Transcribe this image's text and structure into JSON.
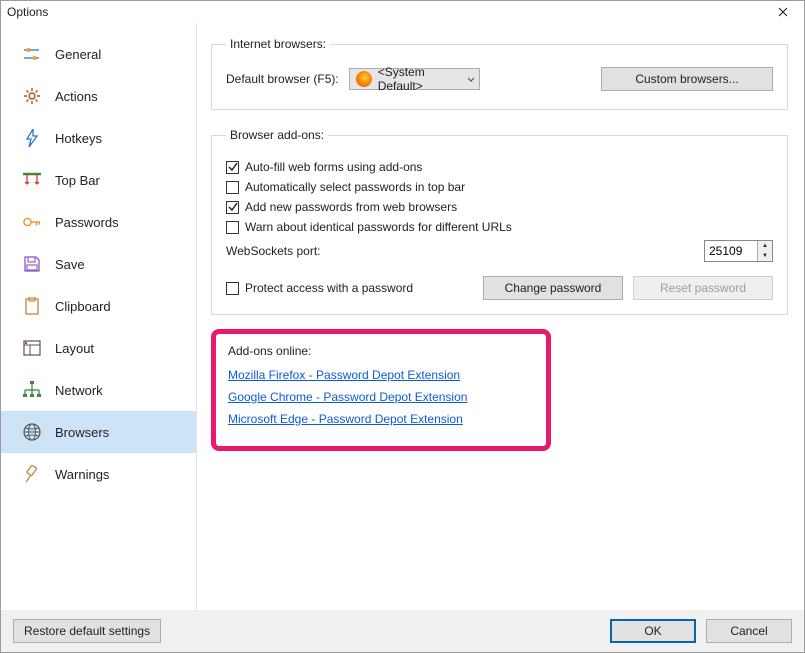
{
  "window": {
    "title": "Options"
  },
  "sidebar": {
    "items": [
      {
        "label": "General"
      },
      {
        "label": "Actions"
      },
      {
        "label": "Hotkeys"
      },
      {
        "label": "Top Bar"
      },
      {
        "label": "Passwords"
      },
      {
        "label": "Save"
      },
      {
        "label": "Clipboard"
      },
      {
        "label": "Layout"
      },
      {
        "label": "Network"
      },
      {
        "label": "Browsers"
      },
      {
        "label": "Warnings"
      }
    ],
    "active_index": 9
  },
  "section_internet": {
    "legend": "Internet browsers:",
    "default_label": "Default browser (F5):",
    "default_value": "<System Default>",
    "custom_button": "Custom browsers..."
  },
  "section_addons": {
    "legend": "Browser add-ons:",
    "autofill": {
      "checked": true,
      "label": "Auto-fill web forms using add-ons"
    },
    "autoselect": {
      "checked": false,
      "label": "Automatically select passwords in top bar"
    },
    "addnew": {
      "checked": true,
      "label": "Add new passwords from web browsers"
    },
    "warn": {
      "checked": false,
      "label": "Warn about identical passwords for different URLs"
    },
    "ws_label": "WebSockets port:",
    "ws_value": "25109",
    "protect": {
      "checked": false,
      "label": "Protect access with a password"
    },
    "change_btn": "Change password",
    "reset_btn": "Reset password"
  },
  "section_online": {
    "legend": "Add-ons online:",
    "links": [
      "Mozilla Firefox - Password Depot Extension",
      "Google Chrome - Password Depot Extension",
      "Microsoft Edge - Password Depot Extension"
    ]
  },
  "footer": {
    "restore": "Restore default settings",
    "ok": "OK",
    "cancel": "Cancel"
  }
}
